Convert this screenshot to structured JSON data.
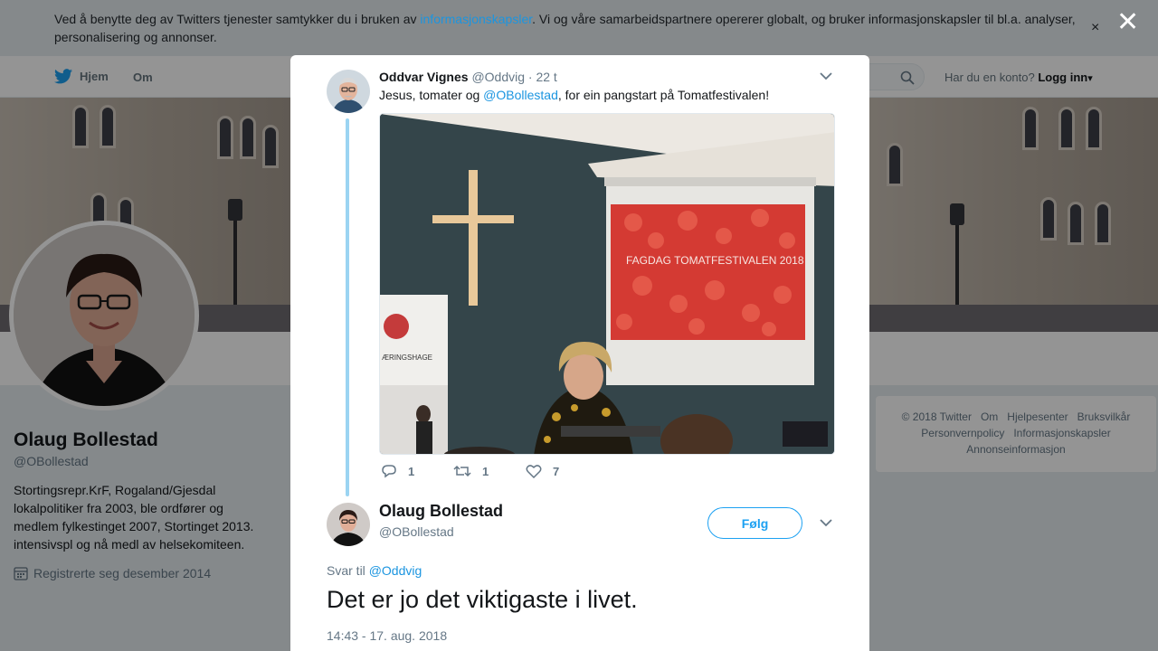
{
  "cookie_notice": {
    "text_before": "Ved å benytte deg av Twitters tjenester samtykker du i bruken av ",
    "link": "informasjonskapsler",
    "text_after": ". Vi og våre samarbeidspartnere opererer globalt, og bruker informasjonskapsler til bl.a. analyser, personalisering og annonser.",
    "close_glyph": "×"
  },
  "modal_close_glyph": "✕",
  "nav": {
    "home_label": "Hjem",
    "about_label": "Om",
    "account_prompt": "Har du en konto?",
    "login_label": "Logg inn",
    "login_caret": "▾"
  },
  "profile": {
    "name": "Olaug Bollestad",
    "handle": "@OBollestad",
    "bio": "Stortingsrepr.KrF, Rogaland/Gjesdal lokalpolitiker fra 2003, ble ordfører og medlem fylkestinget 2007, Stortinget 2013. intensivspl og nå medl av helsekomiteen.",
    "joined": "Registrerte seg desember 2014"
  },
  "footer": {
    "links": [
      "© 2018 Twitter",
      "Om",
      "Hjelpesenter",
      "Bruksvilkår",
      "Personvernpolicy",
      "Informasjonskapsler",
      "Annonseinformasjon"
    ]
  },
  "parent_tweet": {
    "author_name": "Oddvar Vignes",
    "author_handle": "@Oddvig",
    "time": "· 22 t",
    "text_before": "Jesus, tomater og ",
    "mention": "@OBollestad",
    "text_after": ", for ein pangstart på Tomatfestivalen!",
    "photo_slide_text": "FAGDAG TOMATFESTIVALEN 2018",
    "photo_banner_text": "ÆRINGSHAGE",
    "replies": "1",
    "retweets": "1",
    "likes": "7"
  },
  "main_tweet": {
    "author_name": "Olaug Bollestad",
    "author_handle": "@OBollestad",
    "follow_label": "Følg",
    "reply_prefix": "Svar til",
    "reply_mention": "@Oddvig",
    "text": "Det er jo det viktigaste i livet.",
    "timestamp": "14:43 - 17. aug. 2018"
  },
  "colors": {
    "accent": "#1da1f2",
    "link": "#1b95e0",
    "reply_line": "#9bd4f2",
    "muted": "#657786"
  }
}
